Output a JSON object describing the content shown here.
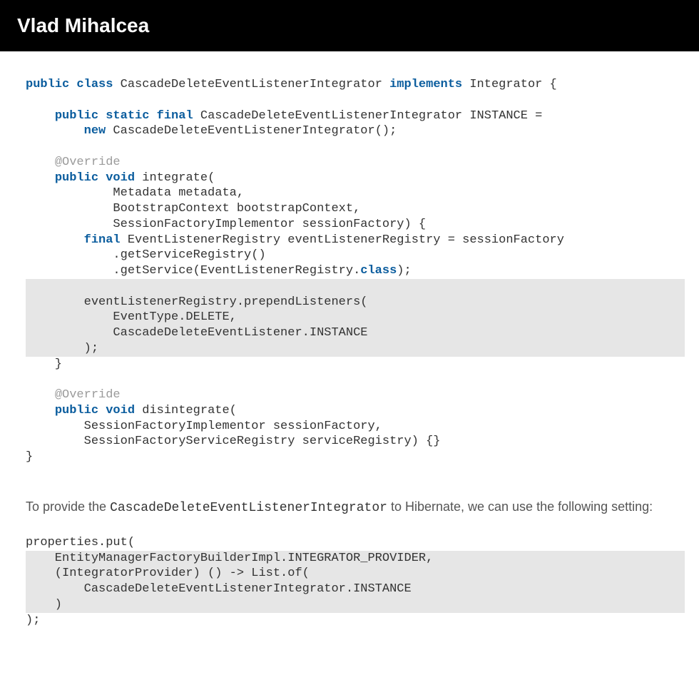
{
  "header": {
    "title": "Vlad Mihalcea"
  },
  "code1": {
    "l1a": "public",
    "l1b": "class",
    "l1c": " CascadeDeleteEventListenerIntegrator ",
    "l1d": "implements",
    "l1e": " Integrator {",
    "l3a": "    ",
    "l3b": "public",
    "l3c": " ",
    "l3d": "static",
    "l3e": " ",
    "l3f": "final",
    "l3g": " CascadeDeleteEventListenerIntegrator INSTANCE =",
    "l4a": "        ",
    "l4b": "new",
    "l4c": " CascadeDeleteEventListenerIntegrator();",
    "l6a": "    ",
    "l6b": "@Override",
    "l7a": "    ",
    "l7b": "public",
    "l7c": " ",
    "l7d": "void",
    "l7e": " integrate(",
    "l8": "            Metadata metadata,",
    "l9": "            BootstrapContext bootstrapContext,",
    "l10": "            SessionFactoryImplementor sessionFactory) {",
    "l11a": "        ",
    "l11b": "final",
    "l11c": " EventListenerRegistry eventListenerRegistry = sessionFactory",
    "l12": "            .getServiceRegistry()",
    "l13a": "            .getService(EventListenerRegistry.",
    "l13b": "class",
    "l13c": ");",
    "h1": "        eventListenerRegistry.prependListeners(",
    "h2": "            EventType.DELETE,",
    "h3": "            CascadeDeleteEventListener.INSTANCE",
    "h4": "        );",
    "l15": "    }",
    "l17a": "    ",
    "l17b": "@Override",
    "l18a": "    ",
    "l18b": "public",
    "l18c": " ",
    "l18d": "void",
    "l18e": " disintegrate(",
    "l19": "        SessionFactoryImplementor sessionFactory,",
    "l20": "        SessionFactoryServiceRegistry serviceRegistry) {}",
    "l21": "}"
  },
  "para": {
    "pre": "To provide the ",
    "code": "CascadeDeleteEventListenerIntegrator",
    "post": " to Hibernate, we can use the following setting:"
  },
  "code2": {
    "l1": "properties.put(",
    "h1": "    EntityManagerFactoryBuilderImpl.INTEGRATOR_PROVIDER,",
    "h2": "    (IntegratorProvider) () -> List.of(",
    "h3": "        CascadeDeleteEventListenerIntegrator.INSTANCE",
    "h4": "    )",
    "l2": ");"
  }
}
